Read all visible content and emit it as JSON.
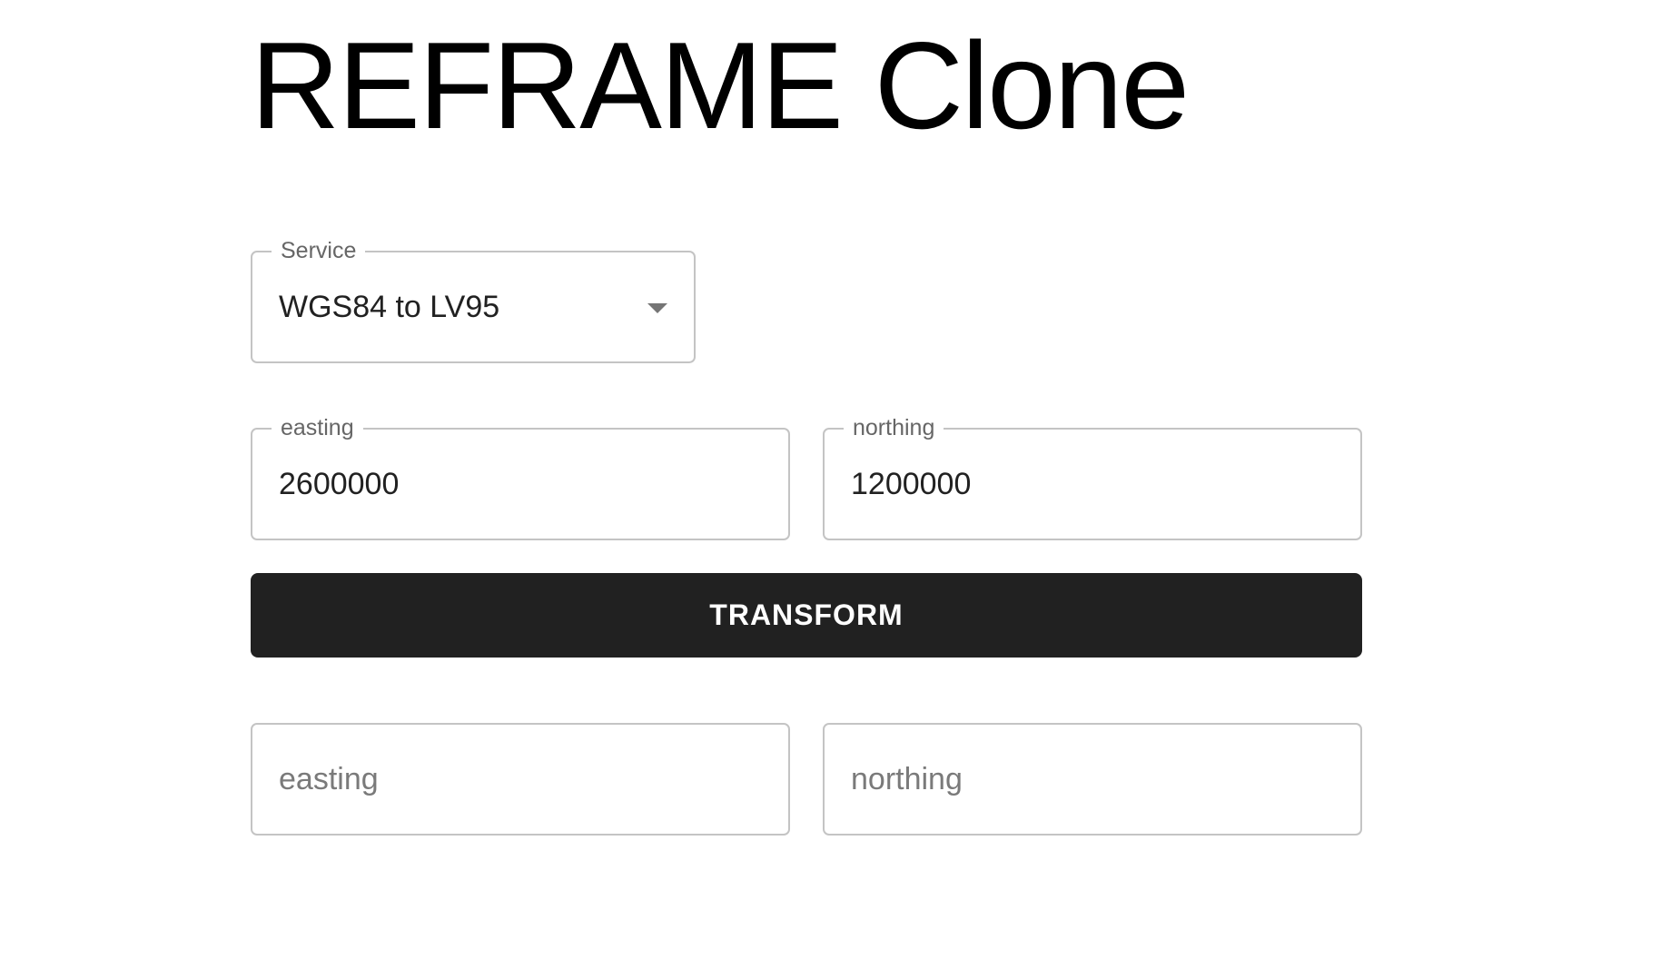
{
  "app": {
    "title": "REFRAME Clone"
  },
  "service": {
    "label": "Service",
    "selected": "WGS84 to LV95",
    "icon": "chevron-down-icon"
  },
  "input": {
    "easting": {
      "label": "easting",
      "value": "2600000"
    },
    "northing": {
      "label": "northing",
      "value": "1200000"
    }
  },
  "actions": {
    "transform_label": "TRANSFORM"
  },
  "output": {
    "easting": {
      "placeholder": "easting",
      "value": ""
    },
    "northing": {
      "placeholder": "northing",
      "value": ""
    }
  },
  "colors": {
    "button_background": "#212121",
    "button_text": "#ffffff",
    "field_border": "#c4c4c4",
    "label_text": "#666666"
  }
}
